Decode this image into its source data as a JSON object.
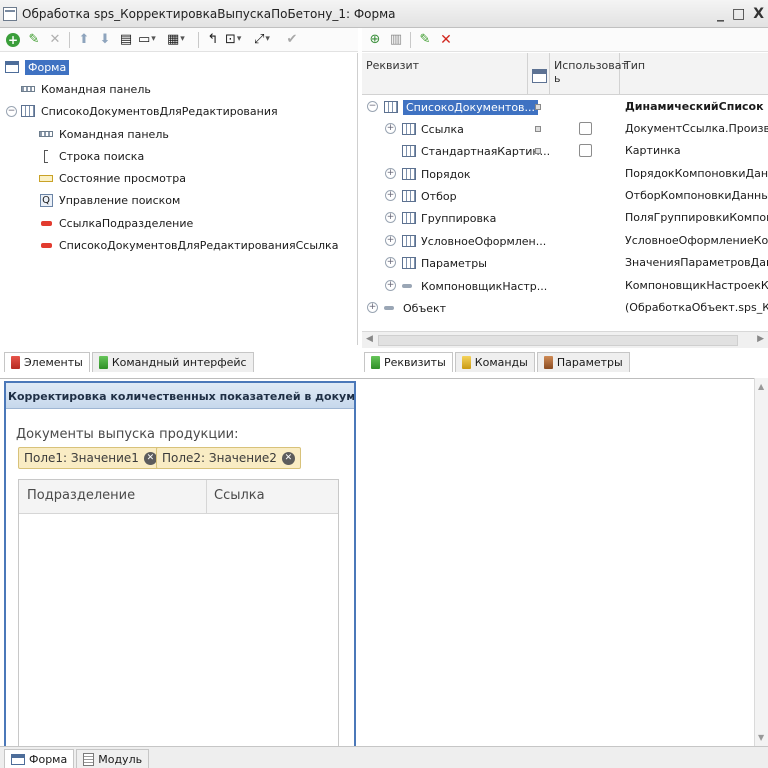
{
  "window": {
    "title": "Обработка sps_КорректировкаВыпускаПоБетону_1: Форма",
    "buttons": {
      "minimize": "_",
      "maximize": "□",
      "close": "X"
    }
  },
  "left_toolbar": {
    "icons": [
      "add-icon",
      "edit-icon",
      "delete-icon",
      "move-up-icon",
      "move-down-icon",
      "structure-icon",
      "form-dropdown-icon",
      "display-dropdown-icon",
      "undo-icon",
      "resize-dropdown-icon",
      "arrows-dropdown-icon",
      "check-icon"
    ]
  },
  "elements_tree": {
    "items": [
      {
        "label": "Форма",
        "icon": "form-icon",
        "selected": true
      },
      {
        "label": "Командная панель",
        "icon": "command-panel-icon"
      },
      {
        "label": "СписокоДокументовДляРедактирования",
        "icon": "table-icon",
        "expanded": true
      },
      {
        "label": "Командная панель",
        "icon": "command-panel-icon"
      },
      {
        "label": "Строка поиска",
        "icon": "search-string-icon"
      },
      {
        "label": "Состояние просмотра",
        "icon": "view-state-icon"
      },
      {
        "label": "Управление поиском",
        "icon": "search-control-icon"
      },
      {
        "label": "СсылкаПодразделение",
        "icon": "field-icon"
      },
      {
        "label": "СписокоДокументовДляРедактированияСсылка",
        "icon": "field-icon"
      }
    ]
  },
  "left_tabs": [
    {
      "label": "Элементы",
      "active": true
    },
    {
      "label": "Командный интерфейс",
      "active": false
    }
  ],
  "right_toolbar": {
    "icons": [
      "add-attribute-icon",
      "attribute-icon",
      "edit-icon",
      "delete-icon"
    ]
  },
  "attributes_grid": {
    "headers": {
      "name": "Реквизит",
      "use": "Использоват ь",
      "type": "Тип"
    },
    "rows": [
      {
        "name": "СписокоДокументов...",
        "type": "ДинамическийСписок",
        "expander": "minus",
        "selected": true,
        "bold_type": true,
        "mark": true
      },
      {
        "name": "Ссылка",
        "type": "ДокументСсылка.Производств",
        "expander": "plus",
        "mark": true,
        "checkbox": true
      },
      {
        "name": "СтандартнаяКартин...",
        "type": "Картинка",
        "mark": true,
        "checkbox": true
      },
      {
        "name": "Порядок",
        "type": "ПорядокКомпоновкиДанных",
        "expander": "plus"
      },
      {
        "name": "Отбор",
        "type": "ОтборКомпоновкиДанных",
        "expander": "plus"
      },
      {
        "name": "Группировка",
        "type": "ПоляГруппировкиКомпоновки",
        "expander": "plus"
      },
      {
        "name": "УсловноеОформлен...",
        "type": "УсловноеОформлениеКомпон",
        "expander": "plus"
      },
      {
        "name": "Параметры",
        "type": "ЗначенияПараметровДанныхК",
        "expander": "plus"
      },
      {
        "name": "КомпоновщикНастр...",
        "type": "КомпоновщикНастроекКомпон",
        "expander": "plus"
      },
      {
        "name": "Объект",
        "type": "(ОбработкаОбъект.sps_Корре",
        "expander": "plus"
      }
    ]
  },
  "right_tabs": [
    {
      "label": "Реквизиты",
      "active": true
    },
    {
      "label": "Команды",
      "active": false
    },
    {
      "label": "Параметры",
      "active": false
    }
  ],
  "form_preview": {
    "header": "Корректировка количественных показателей в документах выпус",
    "label": "Документы выпуска продукции:",
    "chips": [
      "Поле1: Значение1",
      "Поле2: Значение2"
    ],
    "table_columns": [
      "Подразделение",
      "Ссылка"
    ]
  },
  "bottom_tabs": [
    {
      "label": "Форма",
      "active": true
    },
    {
      "label": "Модуль",
      "active": false
    }
  ]
}
